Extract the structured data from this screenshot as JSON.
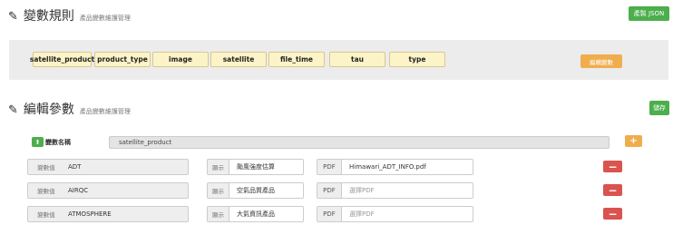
{
  "variable_rules": {
    "title": "變數規則",
    "subtitle": "產品變數維護管理",
    "create_json_label": "產製 JSON",
    "tags": [
      "satellite_product",
      "product_type",
      "image",
      "satellite",
      "file_time",
      "tau",
      "type"
    ],
    "edit_button_label": "編輯變數"
  },
  "edit_params": {
    "title": "編輯參數",
    "subtitle": "產品變數維護管理",
    "save_label": "儲存",
    "name_label": "變數名稱",
    "name_value": "satellite_product",
    "add_label": "+",
    "rows": [
      {
        "value_label": "變數值",
        "value": "ADT",
        "display_label": "顯示",
        "display": "颱風強度估算",
        "pdf_label": "PDF",
        "pdf": "Himawari_ADT_INFO.pdf",
        "pdf_placeholder": false
      },
      {
        "value_label": "變數值",
        "value": "AIRQC",
        "display_label": "顯示",
        "display": "空氣品質產品",
        "pdf_label": "PDF",
        "pdf": "選擇PDF",
        "pdf_placeholder": true
      },
      {
        "value_label": "變數值",
        "value": "ATMOSPHERE",
        "display_label": "顯示",
        "display": "大氣資訊產品",
        "pdf_label": "PDF",
        "pdf": "選擇PDF",
        "pdf_placeholder": true
      }
    ],
    "delete_label": "−"
  },
  "icons": {
    "pencil": "pencil-icon",
    "plus": "plus-icon",
    "minus": "minus-icon",
    "upload": "upload-icon"
  },
  "colors": {
    "green": "#4cae4c",
    "orange": "#f0ad4e",
    "red": "#d9534f",
    "tag_bg": "#fdf3c8"
  }
}
